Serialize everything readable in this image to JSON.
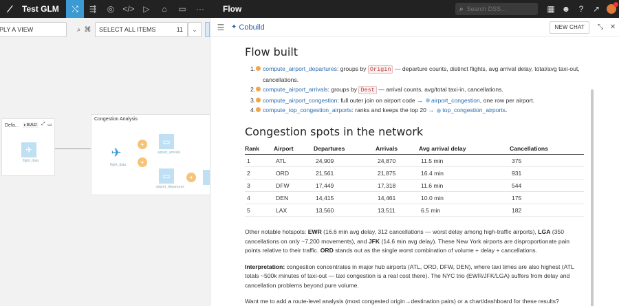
{
  "nav": {
    "project_name": "Test GLM",
    "flow_label": "Flow",
    "search_placeholder": "Search DSS..."
  },
  "flow": {
    "apply_view": "PLY A VIEW",
    "select_all": "SELECT ALL ITEMS",
    "select_count": "11",
    "zone_default_title": "Defa...",
    "zone_default_build": "▸ BUILD",
    "zone_congestion_title": "Congestion Analysis",
    "label_flight_data": "flight_data",
    "label_flight_data2": "flight_data",
    "label_airport_arrivals": "airport_arrivals",
    "label_airport_departures": "airport_departures"
  },
  "panel": {
    "title": "Cobuild",
    "new_chat": "NEW CHAT"
  },
  "chat": {
    "heading1": "Flow built",
    "steps": [
      {
        "num": "1.",
        "link": "compute_airport_departures",
        "pre": ": groups by ",
        "code": "Origin",
        "post": " — departure counts, distinct flights, avg arrival delay, total/avg taxi-out, cancellations."
      },
      {
        "num": "2.",
        "link": "compute_airport_arrivals",
        "pre": ": groups by ",
        "code": "Dest",
        "post": " — arrival counts, avg/total taxi-in, cancellations."
      },
      {
        "num": "3.",
        "link": "compute_airport_congestion",
        "pre": ": full outer join on airport code → ",
        "ds": "airport_congestion",
        "post": ", one row per airport."
      },
      {
        "num": "4.",
        "link": "compute_top_congestion_airports",
        "pre": ": ranks and keeps the top 20 → ",
        "ds": "top_congestion_airports",
        "post": "."
      }
    ],
    "heading2": "Congestion spots in the network",
    "table": {
      "headers": [
        "Rank",
        "Airport",
        "Departures",
        "Arrivals",
        "Avg arrival delay",
        "Cancellations"
      ],
      "rows": [
        [
          "1",
          "ATL",
          "24,909",
          "24,870",
          "11.5 min",
          "375"
        ],
        [
          "2",
          "ORD",
          "21,561",
          "21,875",
          "16.4 min",
          "931"
        ],
        [
          "3",
          "DFW",
          "17,449",
          "17,318",
          "11.6 min",
          "544"
        ],
        [
          "4",
          "DEN",
          "14,415",
          "14,461",
          "10.0 min",
          "175"
        ],
        [
          "5",
          "LAX",
          "13,560",
          "13,511",
          "6.5 min",
          "182"
        ]
      ]
    },
    "p1": {
      "a": "Other notable hotspots: ",
      "ewr": "EWR",
      "b": " (16.6 min avg delay, 312 cancellations — worst delay among high-traffic airports), ",
      "lga": "LGA",
      "c": " (350 cancellations on only ~7,200 movements), and ",
      "jfk": "JFK",
      "d": " (14.6 min avg delay). These New York airports are disproportionate pain points relative to their traffic. ",
      "ord": "ORD",
      "e": " stands out as the single worst combination of volume + delay + cancellations."
    },
    "p2": {
      "label": "Interpretation:",
      "text": " congestion concentrates in major hub airports (ATL, ORD, DFW, DEN), where taxi times are also highest (ATL totals ~500k minutes of taxi-out — taxi congestion is a real cost there). The NYC trio (EWR/JFK/LGA) suffers from delay and cancellation problems beyond pure volume."
    },
    "p3": "Want me to add a route-level analysis (most congested origin→destination pairs) or a chart/dashboard for these results?"
  }
}
